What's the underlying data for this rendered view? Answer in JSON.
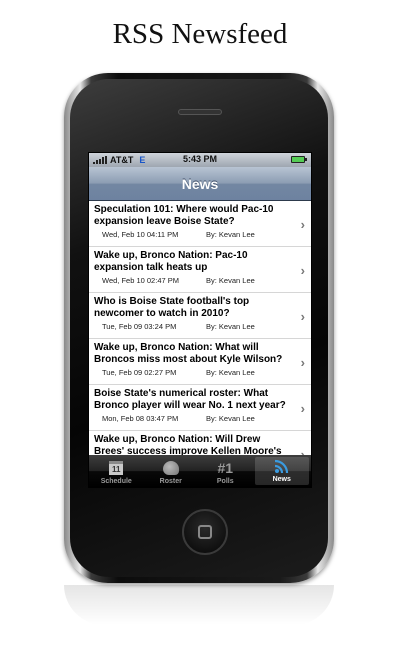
{
  "page": {
    "title": "RSS Newsfeed"
  },
  "status_bar": {
    "carrier": "AT&T",
    "network": "E",
    "time": "5:43 PM"
  },
  "nav": {
    "title": "News"
  },
  "news": [
    {
      "headline": "Speculation 101: Where would Pac-10 expansion leave Boise State?",
      "date": "Wed, Feb 10 04:11 PM",
      "author": "By:  Kevan Lee"
    },
    {
      "headline": "Wake up, Bronco Nation: Pac-10 expansion talk heats up",
      "date": "Wed, Feb 10 02:47 PM",
      "author": "By:  Kevan Lee"
    },
    {
      "headline": "Who is Boise State football's top newcomer to watch in 2010?",
      "date": "Tue, Feb 09 03:24 PM",
      "author": "By:  Kevan Lee"
    },
    {
      "headline": "Wake up, Bronco Nation: What will Broncos miss most about Kyle Wilson?",
      "date": "Tue, Feb 09 02:27 PM",
      "author": "By:  Kevan Lee"
    },
    {
      "headline": "Boise State's numerical roster: What Bronco player will wear No. 1 next year?",
      "date": "Mon, Feb 08 03:47 PM",
      "author": "By:  Kevan Lee"
    },
    {
      "headline": "Wake up, Bronco Nation: Will Drew Brees' success improve Kellen Moore's NFL",
      "date": "",
      "author": ""
    }
  ],
  "tabs": [
    {
      "label": "Schedule",
      "icon": "calendar-icon",
      "icon_text": "11",
      "active": false
    },
    {
      "label": "Roster",
      "icon": "helmet-icon",
      "active": false
    },
    {
      "label": "Polls",
      "icon": "rank-icon",
      "icon_text": "#1",
      "active": false
    },
    {
      "label": "News",
      "icon": "rss-icon",
      "active": true
    }
  ],
  "colors": {
    "rss_accent": "#3a9be0",
    "nav_bar": "#8194ad"
  }
}
